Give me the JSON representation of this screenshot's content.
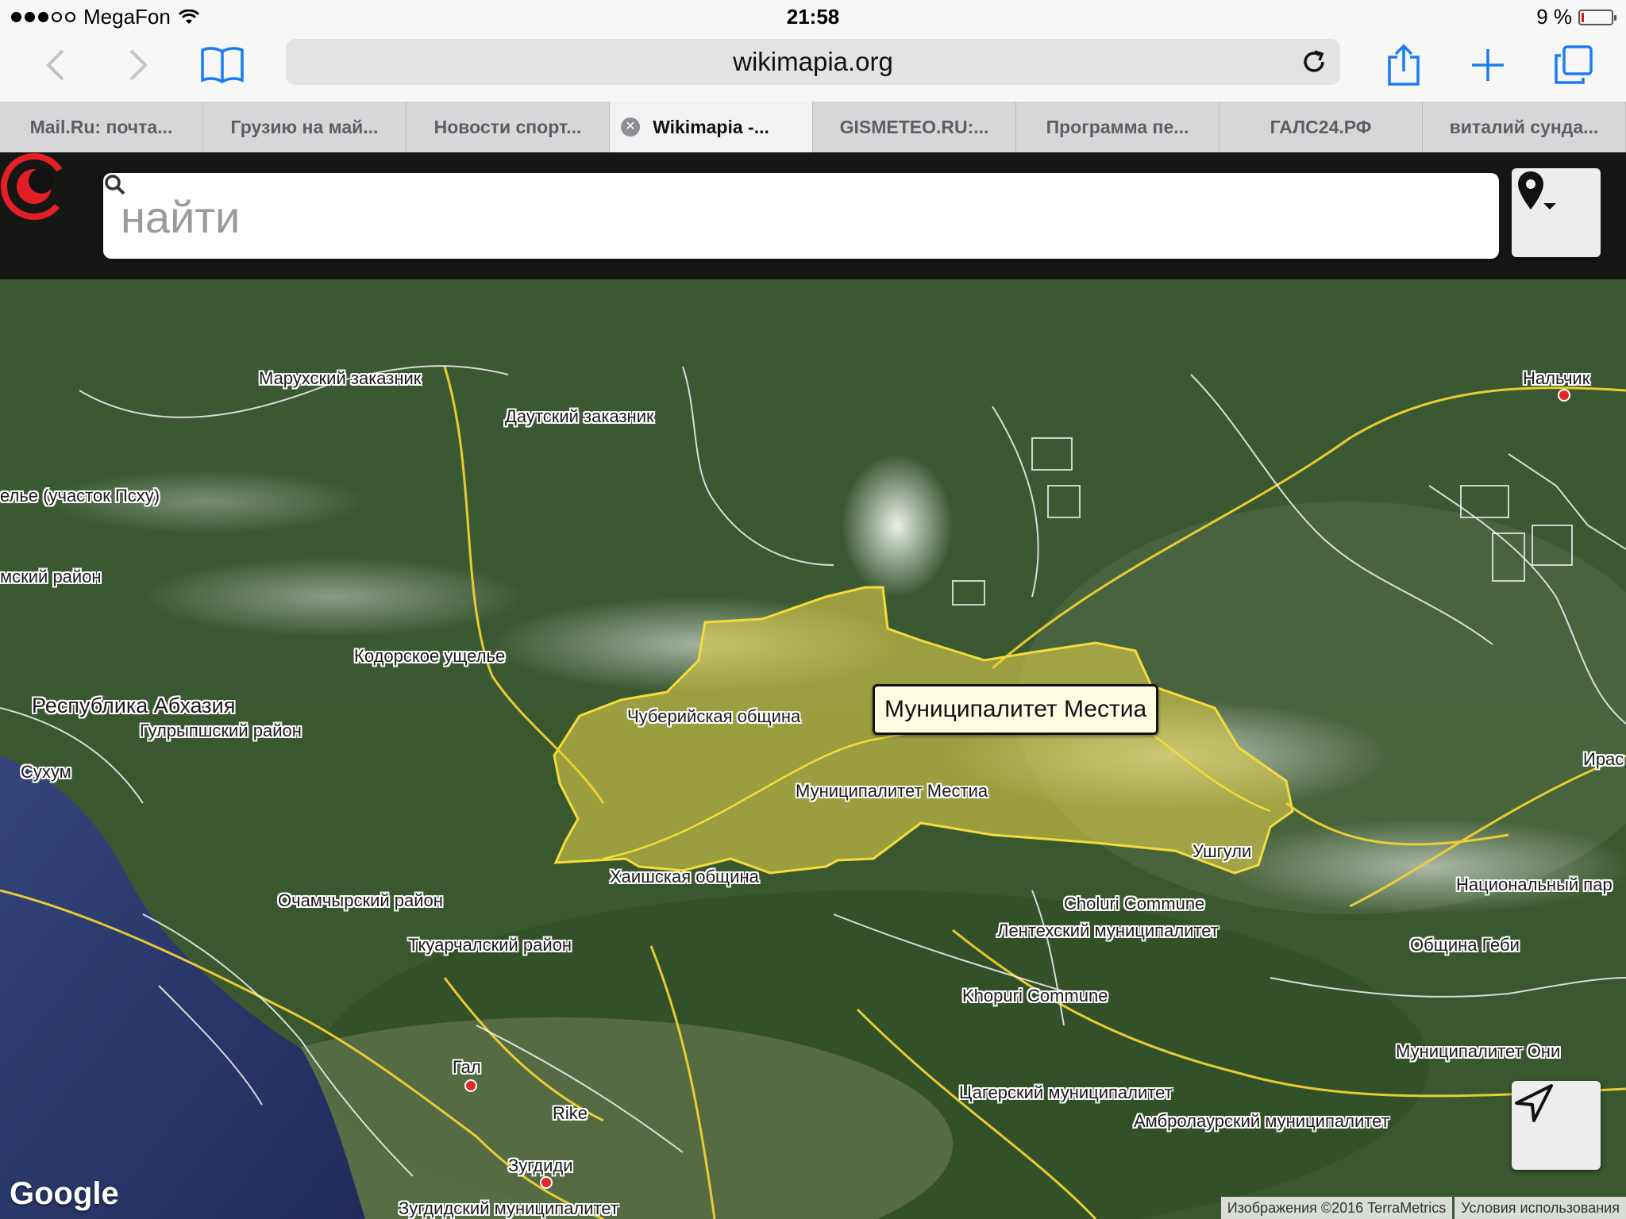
{
  "status_bar": {
    "carrier": "MegaFon",
    "time": "21:58",
    "battery_text": "9 %",
    "battery_level": 0.09
  },
  "browser": {
    "url": "wikimapia.org",
    "tabs": [
      {
        "label": "Mail.Ru: почта..."
      },
      {
        "label": "Грузию на май..."
      },
      {
        "label": "Новости спорт..."
      },
      {
        "label": "Wikimapia -..."
      },
      {
        "label": "GISMETEO.RU:..."
      },
      {
        "label": "Программа пе..."
      },
      {
        "label": "ГАЛС24.РФ"
      },
      {
        "label": "виталий сунда..."
      }
    ],
    "active_tab_index": 3
  },
  "search": {
    "placeholder": "найти"
  },
  "map": {
    "popup": "Муниципалитет Местиа",
    "labels": [
      "Марухский заказник",
      "Даутский заказник",
      "елье (участок Псху)",
      "мский район",
      "Кодорское ущелье",
      "Республика Абхазия",
      "Гулрыпшский район",
      "Сухум",
      "Чуберийская община",
      "Муниципалитет Местиа",
      "Хаишская община",
      "Ушгули",
      "Choluri Commune",
      "Лентехский муниципалитет",
      "Очамчырский район",
      "Ткуарчалский район",
      "Khopuri Commune",
      "Гал",
      "Rike",
      "Зугдиди",
      "Зугдидский муниципалитет",
      "Цагерский муниципалитет",
      "Амбролаурский муниципалитет",
      "Муниципалитет Они",
      "Община Геби",
      "Национальный пар",
      "Ирас",
      "Нальчик"
    ],
    "provider": "Google",
    "attribution": "Изображения ©2016 TerraMetrics",
    "terms": "Условия использования"
  },
  "colors": {
    "highlight": "#e0cf48",
    "logo": "#e41e25",
    "roads": "#f2d232"
  }
}
